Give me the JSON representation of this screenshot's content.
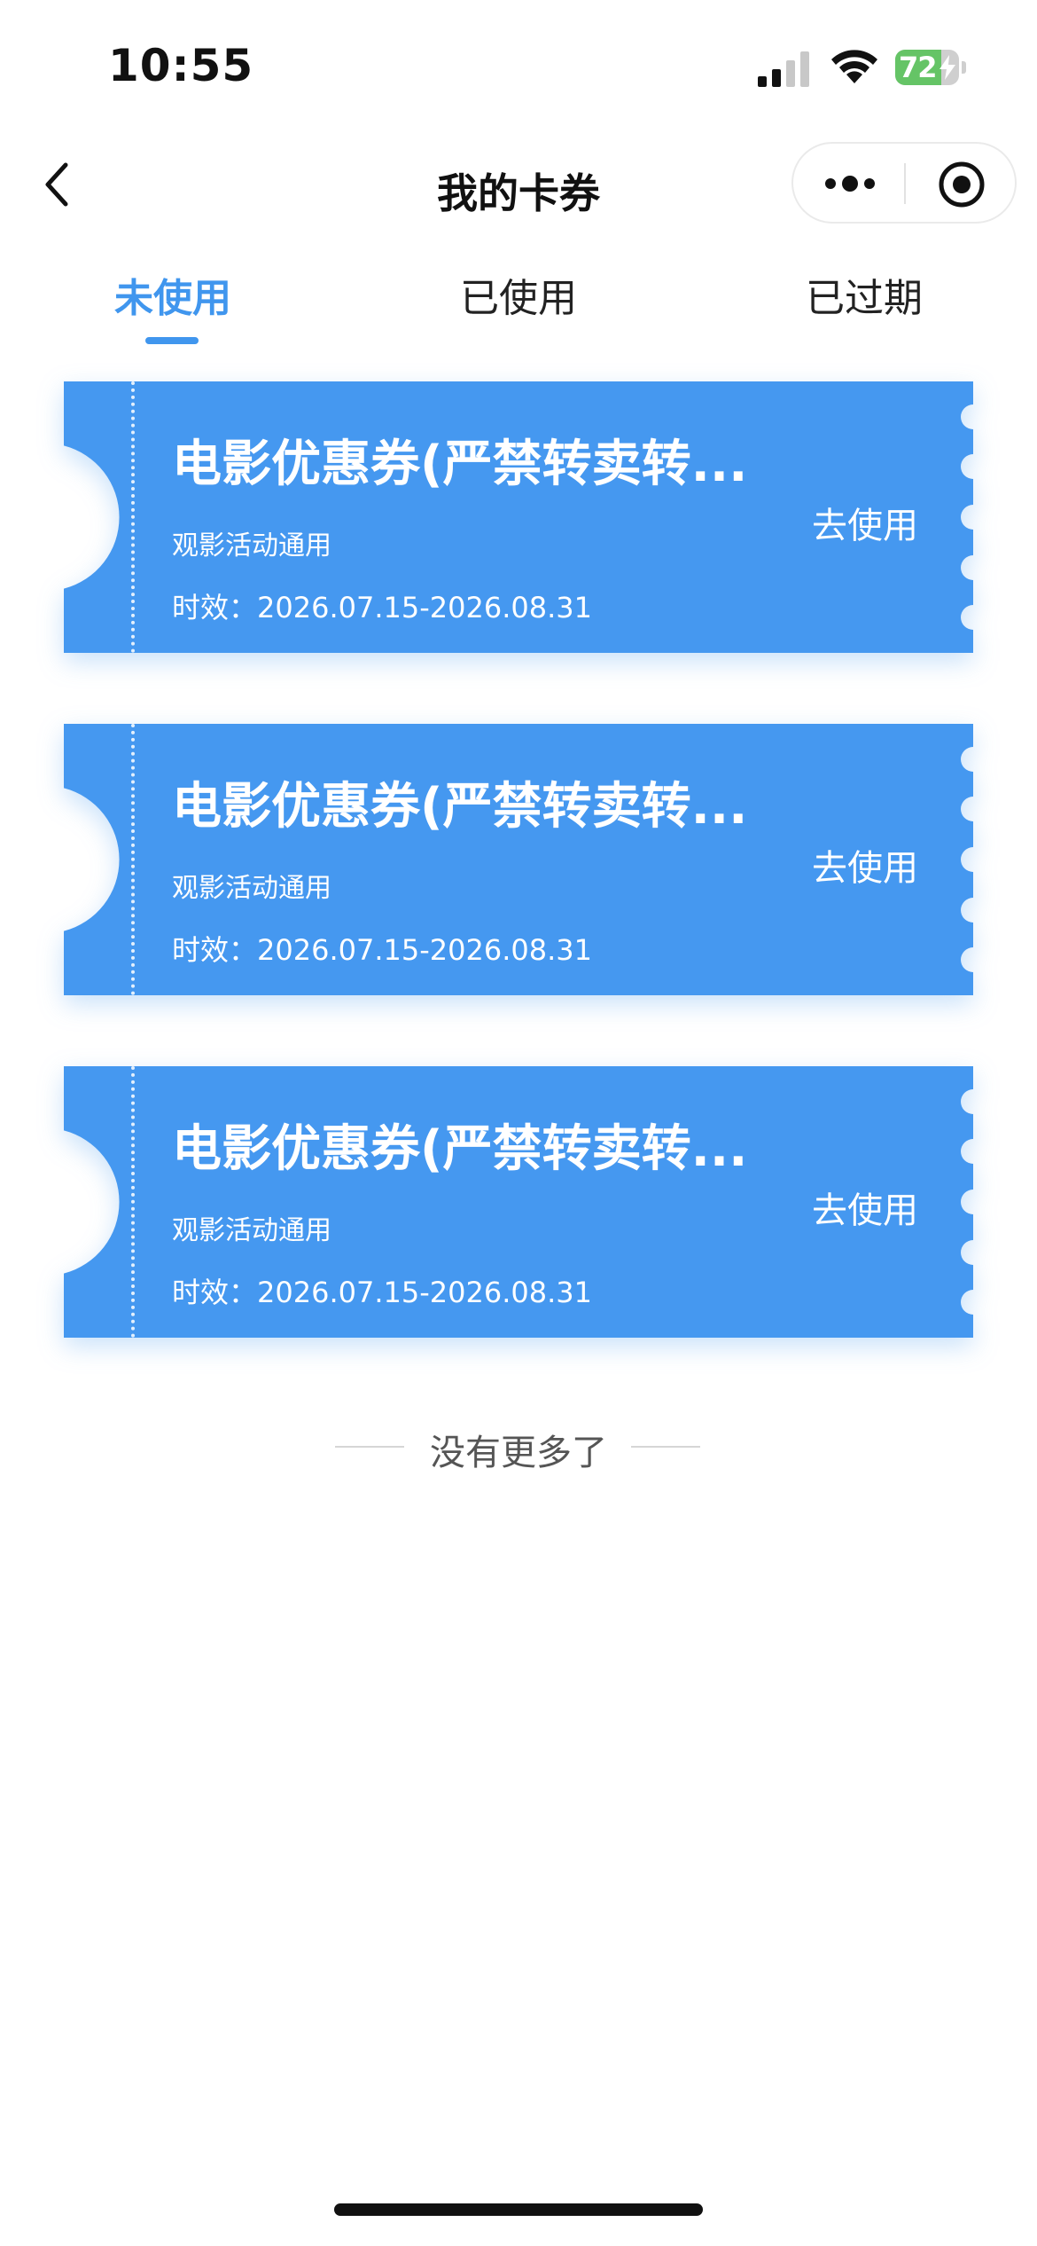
{
  "status_bar": {
    "time": "10:55",
    "battery_percent": "72",
    "battery_level": 0.72
  },
  "nav": {
    "title": "我的卡券"
  },
  "tabs": [
    {
      "label": "未使用",
      "active": true
    },
    {
      "label": "已使用",
      "active": false
    },
    {
      "label": "已过期",
      "active": false
    }
  ],
  "coupons": [
    {
      "title": "电影优惠券(严禁转卖转...",
      "subtitle": "观影活动通用",
      "validity": "时效：2026.07.15-2026.08.31",
      "action": "去使用"
    },
    {
      "title": "电影优惠券(严禁转卖转...",
      "subtitle": "观影活动通用",
      "validity": "时效：2026.07.15-2026.08.31",
      "action": "去使用"
    },
    {
      "title": "电影优惠券(严禁转卖转...",
      "subtitle": "观影活动通用",
      "validity": "时效：2026.07.15-2026.08.31",
      "action": "去使用"
    }
  ],
  "list_end_text": "没有更多了",
  "colors": {
    "accent": "#4096ee",
    "coupon_bg": "#4598f0",
    "battery_green": "#65c466"
  },
  "icons": {
    "back": "chevron-left-icon",
    "more": "more-dots-icon",
    "close": "target-circle-icon",
    "signal": "cellular-signal-icon",
    "wifi": "wifi-icon",
    "battery": "battery-icon"
  }
}
